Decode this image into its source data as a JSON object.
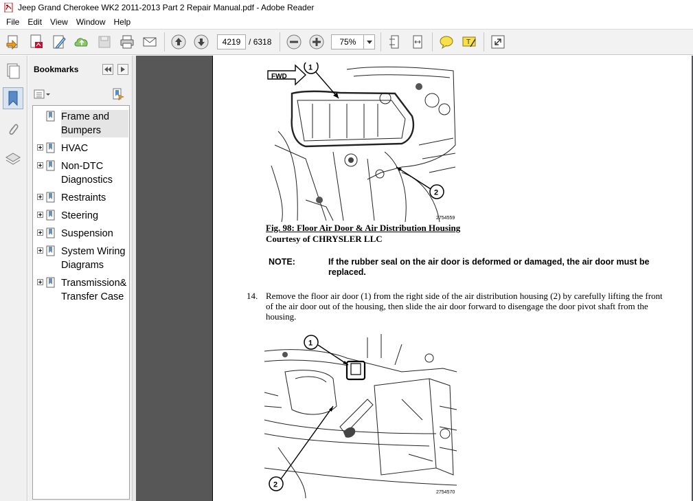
{
  "window": {
    "title": "Jeep Grand Cherokee WK2 2011-2013 Part 2 Repair Manual.pdf - Adobe Reader",
    "app_icon": "pdf-icon"
  },
  "menu": {
    "items": [
      "File",
      "Edit",
      "View",
      "Window",
      "Help"
    ]
  },
  "toolbar": {
    "current_page": "4219",
    "page_separator": "/",
    "total_pages": "6318",
    "zoom": "75%",
    "buttons": [
      "create-pdf-icon",
      "export-pdf-icon",
      "edit-icon",
      "upload-icon",
      "save-icon",
      "print-icon",
      "email-icon",
      "prev-page-icon",
      "next-page-icon",
      "zoom-out-icon",
      "zoom-in-icon",
      "fit-page-icon",
      "fit-width-icon",
      "comment-icon",
      "highlight-icon",
      "expand-icon"
    ]
  },
  "bookmarks": {
    "title": "Bookmarks",
    "items": [
      {
        "label": "Frame and Bumpers",
        "expandable": false,
        "selected": true
      },
      {
        "label": "HVAC",
        "expandable": true,
        "selected": false
      },
      {
        "label": "Non-DTC Diagnostics",
        "expandable": true,
        "selected": false
      },
      {
        "label": "Restraints",
        "expandable": true,
        "selected": false
      },
      {
        "label": "Steering",
        "expandable": true,
        "selected": false
      },
      {
        "label": "Suspension",
        "expandable": true,
        "selected": false
      },
      {
        "label": "System Wiring Diagrams",
        "expandable": true,
        "selected": false
      },
      {
        "label": "Transmission& Transfer Case",
        "expandable": true,
        "selected": false
      }
    ]
  },
  "document": {
    "fig1": {
      "fwd_label": "FWD",
      "callout_1": "1",
      "callout_2": "2",
      "id": "2754559",
      "caption": "Fig. 98: Floor Air Door & Air Distribution Housing",
      "courtesy": "Courtesy of CHRYSLER LLC"
    },
    "note": {
      "label": "NOTE:",
      "text": "If the rubber seal on the air door is deformed or damaged, the air door must be replaced."
    },
    "step": {
      "number": "14.",
      "text": "Remove the floor air door (1) from the right side of the air distribution housing (2) by carefully lifting the front of the air door out of the housing, then slide the air door forward to disengage the door pivot shaft from the housing."
    },
    "fig2": {
      "callout_1": "1",
      "callout_2": "2",
      "id": "2754570"
    }
  }
}
